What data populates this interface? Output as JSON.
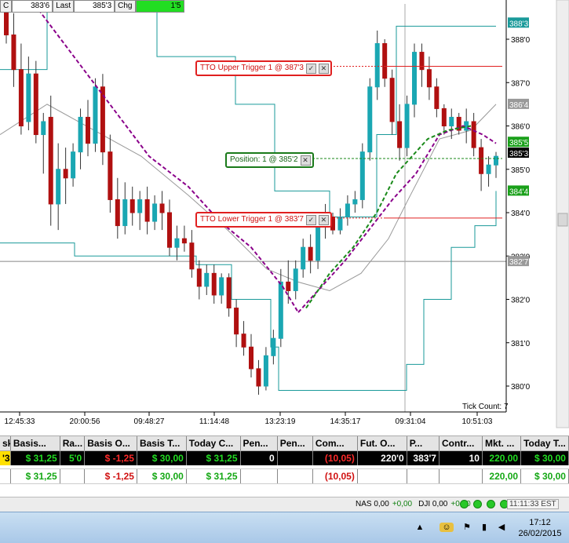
{
  "infobar": {
    "c_label": "C",
    "c_value": "383'6",
    "last_label": "Last",
    "last_value": "385'3",
    "chg_label": "Chg",
    "chg_value": "1'5"
  },
  "chart": {
    "y_ticks": [
      "388'0",
      "387'0",
      "386'0",
      "385'0",
      "384'0",
      "383'0",
      "382'0",
      "381'0",
      "380'0"
    ],
    "x_ticks": [
      "12:45:33",
      "20:00:56",
      "09:48:27",
      "11:14:48",
      "13:23:19",
      "14:35:17",
      "09:31:04",
      "10:51:03"
    ],
    "tick_count_label": "Tick Count:  7",
    "price_tags": [
      {
        "text": "388'3",
        "kind": "teal"
      },
      {
        "text": "386'4",
        "kind": "gray"
      },
      {
        "text": "385'5",
        "kind": "green"
      },
      {
        "text": "385'3",
        "kind": "black"
      },
      {
        "text": "384'4",
        "kind": "green"
      },
      {
        "text": "382'7",
        "kind": "gray"
      }
    ],
    "orders": {
      "upper": "TTO Upper Trigger 1 @ 387'3",
      "position": "Position: 1 @ 385'2",
      "lower": "TTO Lower Trigger 1 @ 383'7"
    },
    "colors": {
      "up_candle": "#1aa7b3",
      "down_candle": "#b01010",
      "ma_purple": "#8a008a",
      "ma_green": "#1a8a1a",
      "channel": "#1a9a9a",
      "order_red": "#e02020",
      "position_green": "#1a8a1a"
    },
    "candles": [
      {
        "o": 388.9,
        "h": 389.3,
        "l": 387.9,
        "c": 388.1
      },
      {
        "o": 388.1,
        "h": 388.6,
        "l": 386.9,
        "c": 387.3
      },
      {
        "o": 387.3,
        "h": 387.9,
        "l": 385.8,
        "c": 386.0
      },
      {
        "o": 386.1,
        "h": 387.6,
        "l": 385.9,
        "c": 387.2
      },
      {
        "o": 387.2,
        "h": 387.5,
        "l": 385.6,
        "c": 385.8
      },
      {
        "o": 385.8,
        "h": 386.3,
        "l": 384.9,
        "c": 386.1
      },
      {
        "o": 386.2,
        "h": 386.7,
        "l": 383.7,
        "c": 384.2
      },
      {
        "o": 384.2,
        "h": 385.6,
        "l": 383.6,
        "c": 385.0
      },
      {
        "o": 385.0,
        "h": 385.5,
        "l": 384.2,
        "c": 384.8
      },
      {
        "o": 384.8,
        "h": 385.6,
        "l": 384.6,
        "c": 385.4
      },
      {
        "o": 385.4,
        "h": 386.4,
        "l": 385.0,
        "c": 386.2
      },
      {
        "o": 386.2,
        "h": 386.6,
        "l": 385.3,
        "c": 385.6
      },
      {
        "o": 385.6,
        "h": 387.1,
        "l": 385.4,
        "c": 386.9
      },
      {
        "o": 386.9,
        "h": 387.2,
        "l": 385.1,
        "c": 385.4
      },
      {
        "o": 385.4,
        "h": 385.8,
        "l": 384.0,
        "c": 384.3
      },
      {
        "o": 384.3,
        "h": 384.8,
        "l": 383.4,
        "c": 383.7
      },
      {
        "o": 383.7,
        "h": 384.7,
        "l": 383.5,
        "c": 384.3
      },
      {
        "o": 384.3,
        "h": 384.6,
        "l": 383.7,
        "c": 384.0
      },
      {
        "o": 384.0,
        "h": 384.5,
        "l": 383.6,
        "c": 384.3
      },
      {
        "o": 384.3,
        "h": 384.6,
        "l": 383.5,
        "c": 383.8
      },
      {
        "o": 383.8,
        "h": 384.4,
        "l": 383.6,
        "c": 384.2
      },
      {
        "o": 384.2,
        "h": 384.5,
        "l": 383.6,
        "c": 384.0
      },
      {
        "o": 384.0,
        "h": 384.3,
        "l": 383.0,
        "c": 383.2
      },
      {
        "o": 383.2,
        "h": 383.7,
        "l": 382.9,
        "c": 383.4
      },
      {
        "o": 383.4,
        "h": 383.7,
        "l": 383.1,
        "c": 383.3
      },
      {
        "o": 383.3,
        "h": 383.6,
        "l": 382.5,
        "c": 382.7
      },
      {
        "o": 382.7,
        "h": 382.9,
        "l": 382.0,
        "c": 382.3
      },
      {
        "o": 382.3,
        "h": 382.8,
        "l": 382.1,
        "c": 382.6
      },
      {
        "o": 382.6,
        "h": 382.8,
        "l": 381.9,
        "c": 382.1
      },
      {
        "o": 382.1,
        "h": 382.6,
        "l": 381.9,
        "c": 382.5
      },
      {
        "o": 382.5,
        "h": 382.6,
        "l": 381.6,
        "c": 381.8
      },
      {
        "o": 381.8,
        "h": 382.0,
        "l": 380.9,
        "c": 381.2
      },
      {
        "o": 381.2,
        "h": 381.5,
        "l": 380.7,
        "c": 380.9
      },
      {
        "o": 380.9,
        "h": 381.2,
        "l": 380.2,
        "c": 380.4
      },
      {
        "o": 380.4,
        "h": 380.6,
        "l": 379.8,
        "c": 380.0
      },
      {
        "o": 380.0,
        "h": 380.9,
        "l": 379.9,
        "c": 380.7
      },
      {
        "o": 380.7,
        "h": 381.3,
        "l": 380.5,
        "c": 381.1
      },
      {
        "o": 381.1,
        "h": 382.7,
        "l": 380.9,
        "c": 382.4
      },
      {
        "o": 382.4,
        "h": 382.9,
        "l": 381.9,
        "c": 382.2
      },
      {
        "o": 382.2,
        "h": 382.9,
        "l": 382.0,
        "c": 382.7
      },
      {
        "o": 382.7,
        "h": 383.4,
        "l": 382.5,
        "c": 383.2
      },
      {
        "o": 383.2,
        "h": 383.5,
        "l": 382.6,
        "c": 382.9
      },
      {
        "o": 382.9,
        "h": 383.9,
        "l": 382.7,
        "c": 383.7
      },
      {
        "o": 383.7,
        "h": 384.2,
        "l": 383.4,
        "c": 383.9
      },
      {
        "o": 383.9,
        "h": 384.0,
        "l": 383.5,
        "c": 383.6
      },
      {
        "o": 383.6,
        "h": 384.1,
        "l": 383.5,
        "c": 383.9
      },
      {
        "o": 383.9,
        "h": 384.4,
        "l": 383.7,
        "c": 384.2
      },
      {
        "o": 384.2,
        "h": 384.5,
        "l": 384.0,
        "c": 384.3
      },
      {
        "o": 384.3,
        "h": 385.6,
        "l": 384.1,
        "c": 385.4
      },
      {
        "o": 385.4,
        "h": 387.1,
        "l": 385.2,
        "c": 386.9
      },
      {
        "o": 386.9,
        "h": 388.2,
        "l": 386.6,
        "c": 387.9
      },
      {
        "o": 387.9,
        "h": 388.0,
        "l": 386.9,
        "c": 387.1
      },
      {
        "o": 387.1,
        "h": 387.3,
        "l": 385.8,
        "c": 386.1
      },
      {
        "o": 386.1,
        "h": 386.5,
        "l": 385.2,
        "c": 385.5
      },
      {
        "o": 385.5,
        "h": 386.7,
        "l": 385.3,
        "c": 386.5
      },
      {
        "o": 386.5,
        "h": 387.9,
        "l": 386.2,
        "c": 387.7
      },
      {
        "o": 387.7,
        "h": 387.9,
        "l": 386.9,
        "c": 387.3
      },
      {
        "o": 387.3,
        "h": 387.6,
        "l": 386.6,
        "c": 386.9
      },
      {
        "o": 386.9,
        "h": 387.1,
        "l": 386.2,
        "c": 386.4
      },
      {
        "o": 386.4,
        "h": 386.5,
        "l": 385.8,
        "c": 386.0
      },
      {
        "o": 386.0,
        "h": 386.4,
        "l": 385.7,
        "c": 386.2
      },
      {
        "o": 386.2,
        "h": 386.3,
        "l": 385.8,
        "c": 385.9
      },
      {
        "o": 385.9,
        "h": 386.4,
        "l": 385.6,
        "c": 386.1
      },
      {
        "o": 386.1,
        "h": 386.3,
        "l": 385.3,
        "c": 385.5
      },
      {
        "o": 385.5,
        "h": 385.7,
        "l": 384.5,
        "c": 384.9
      },
      {
        "o": 384.9,
        "h": 385.3,
        "l": 384.6,
        "c": 385.1
      },
      {
        "o": 385.1,
        "h": 385.4,
        "l": 384.8,
        "c": 385.3
      }
    ]
  },
  "grid": {
    "headers": [
      "sk",
      "Basis...",
      "Ra...",
      "Basis O...",
      "Basis T...",
      "Today C...",
      "Pen...",
      "Pen...",
      "Com...",
      "Fut. O...",
      "P...",
      "Contr...",
      "Mkt. ...",
      "Today T..."
    ],
    "row": [
      "'3",
      "$ 31,25",
      "5'0",
      "$ -1,25",
      "$ 30,00",
      "$ 31,25",
      "0",
      "",
      "(10,05)",
      "220'0",
      "383'7",
      "10",
      "220,00",
      "$ 30,00"
    ],
    "totals": [
      "",
      "$ 31,25",
      "",
      "$ -1,25",
      "$ 30,00",
      "$ 31,25",
      "",
      "",
      "(10,05)",
      "",
      "",
      "",
      "220,00",
      "$ 30,00"
    ]
  },
  "status": {
    "nas": "NAS 0,00",
    "nas_chg": "+0,00",
    "dji": "DJI 0,00",
    "dji_chg": "+0,00",
    "time": "11:11:33 EST"
  },
  "taskbar": {
    "time": "17:12",
    "date": "26/02/2015"
  }
}
